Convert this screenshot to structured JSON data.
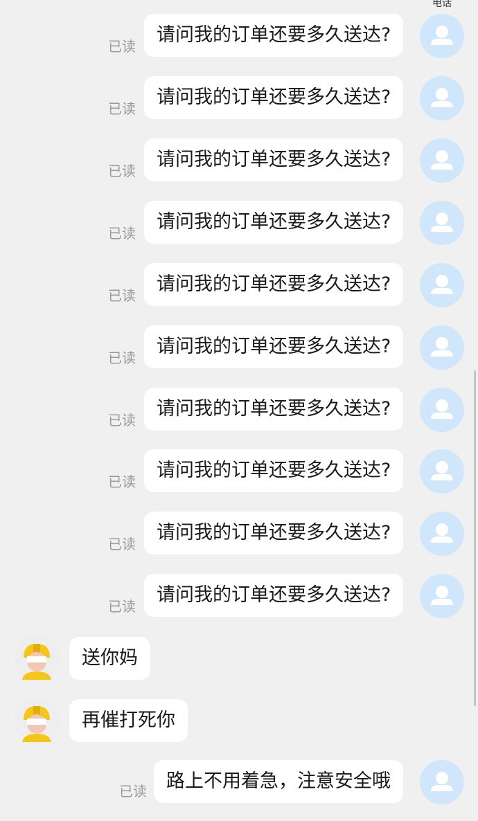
{
  "top_clip": "电话",
  "messages": [
    {
      "from": "me",
      "text": "请问我的订单还要多久送达?",
      "status": "已读"
    },
    {
      "from": "me",
      "text": "请问我的订单还要多久送达?",
      "status": "已读"
    },
    {
      "from": "me",
      "text": "请问我的订单还要多久送达?",
      "status": "已读"
    },
    {
      "from": "me",
      "text": "请问我的订单还要多久送达?",
      "status": "已读"
    },
    {
      "from": "me",
      "text": "请问我的订单还要多久送达?",
      "status": "已读"
    },
    {
      "from": "me",
      "text": "请问我的订单还要多久送达?",
      "status": "已读"
    },
    {
      "from": "me",
      "text": "请问我的订单还要多久送达?",
      "status": "已读"
    },
    {
      "from": "me",
      "text": "请问我的订单还要多久送达?",
      "status": "已读"
    },
    {
      "from": "me",
      "text": "请问我的订单还要多久送达?",
      "status": "已读"
    },
    {
      "from": "me",
      "text": "请问我的订单还要多久送达?",
      "status": "已读"
    },
    {
      "from": "rider",
      "text": "送你妈"
    },
    {
      "from": "rider",
      "text": "再催打死你"
    },
    {
      "from": "me",
      "text": "路上不用着急，注意安全哦",
      "status": "已读"
    }
  ],
  "colors": {
    "background": "#f0f0f0",
    "bubble": "#ffffff",
    "read_status": "#9a9a9a",
    "user_avatar": "#cfe6fb",
    "rider_helmet": "#f5c518"
  },
  "icons": {
    "user_avatar": "person-silhouette-icon",
    "rider_avatar": "delivery-rider-helmet-icon"
  }
}
